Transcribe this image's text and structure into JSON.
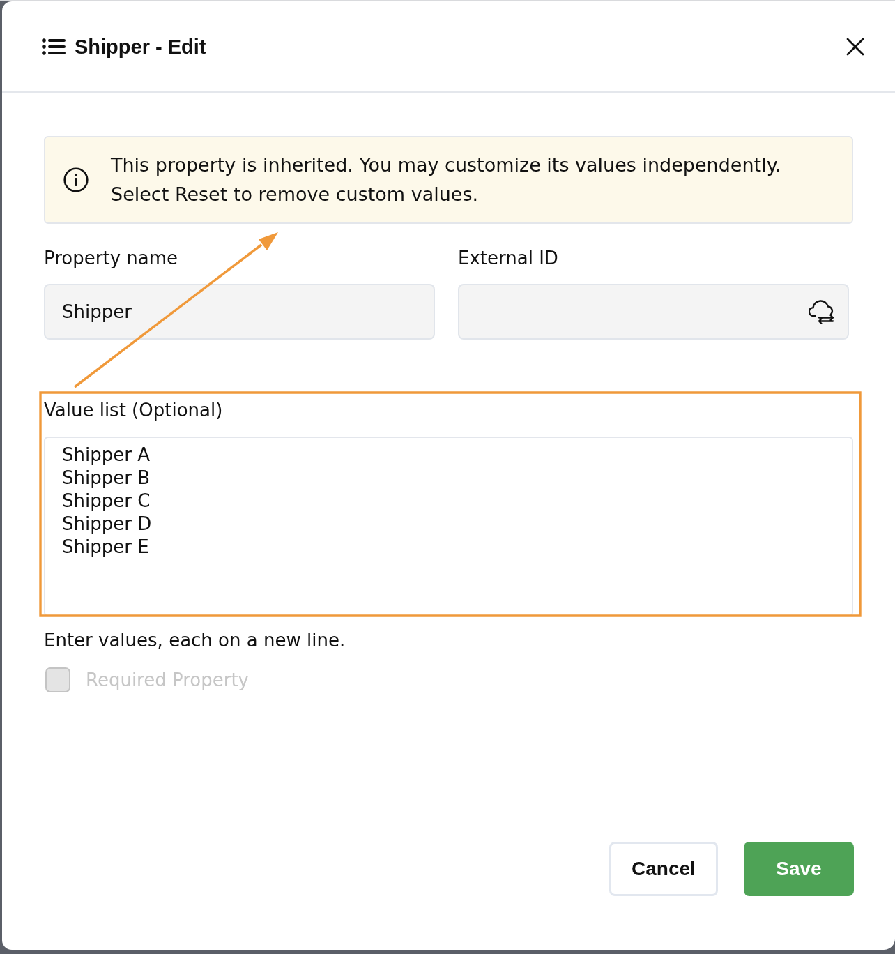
{
  "dialog": {
    "title": "Shipper - Edit"
  },
  "notice": {
    "text": "This property is inherited. You may customize its values independently. Select Reset to remove custom values."
  },
  "fields": [
    {
      "label": "Property name",
      "kind": "text",
      "value": "Shipper"
    },
    {
      "label": "External ID",
      "kind": "sync"
    }
  ],
  "value_list": {
    "label": "Value list (Optional)",
    "values": [
      "Shipper A",
      "Shipper B",
      "Shipper C",
      "Shipper D",
      "Shipper E"
    ],
    "hint": "Enter values, each on a new line."
  },
  "required": {
    "label": "Required Property",
    "checked": false,
    "disabled": true
  },
  "buttons": [
    {
      "label": "Cancel",
      "kind": "secondary"
    },
    {
      "label": "Save",
      "kind": "primary"
    }
  ]
}
